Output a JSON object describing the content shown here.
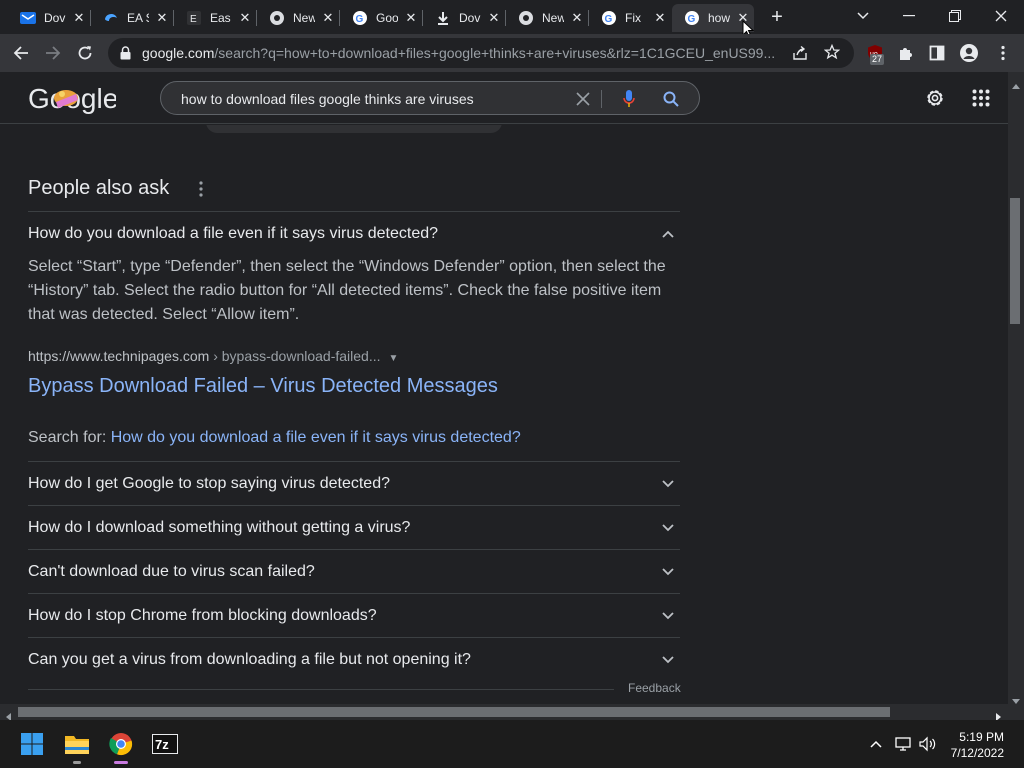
{
  "browser": {
    "tabs": [
      {
        "title": "Dov",
        "icon": "mail-icon"
      },
      {
        "title": "EA S",
        "icon": "edge-icon"
      },
      {
        "title": "Eas",
        "icon": "e-icon"
      },
      {
        "title": "New",
        "icon": "chromium-icon"
      },
      {
        "title": "Goo",
        "icon": "google-icon"
      },
      {
        "title": "Dov",
        "icon": "download-icon"
      },
      {
        "title": "New",
        "icon": "chromium-icon"
      },
      {
        "title": "Fix",
        "icon": "google-icon"
      },
      {
        "title": "how",
        "icon": "google-icon"
      }
    ],
    "new_tab_label": "+",
    "url_host": "google.com",
    "url_rest": "/search?q=how+to+download+files+google+thinks+are+viruses&rlz=1C1GCEU_enUS99...",
    "extension_badge": "27"
  },
  "google": {
    "logo_text": "Google",
    "query": "how to download files google thinks are viruses"
  },
  "paa": {
    "title": "People also ask",
    "expanded_question": "How do you download a file even if it says virus detected?",
    "answer": "Select “Start”, type “Defender”, then select the “Windows Defender” option, then select the “History” tab. Select the radio button for “All detected items”. Check the false positive item that was detected. Select “Allow item”.",
    "source_url": "https://www.technipages.com",
    "source_crumb": " › bypass-download-failed...",
    "source_title": "Bypass Download Failed – Virus Detected Messages",
    "search_for_label": "Search for: ",
    "search_for_link": "How do you download a file even if it says virus detected?",
    "questions": [
      "How do I get Google to stop saying virus detected?",
      "How do I download something without getting a virus?",
      "Can't download due to virus scan failed?",
      "How do I stop Chrome from blocking downloads?",
      "Can you get a virus from downloading a file but not opening it?"
    ],
    "feedback": "Feedback"
  },
  "taskbar": {
    "time": "5:19 PM",
    "date": "7/12/2022",
    "apps": [
      "windows-start-icon",
      "file-explorer-icon",
      "chrome-icon",
      "7zip-icon"
    ],
    "sevenzip_label": "7z"
  },
  "colors": {
    "link": "#8ab4f8",
    "background": "#202124",
    "text": "#e8eaed"
  }
}
